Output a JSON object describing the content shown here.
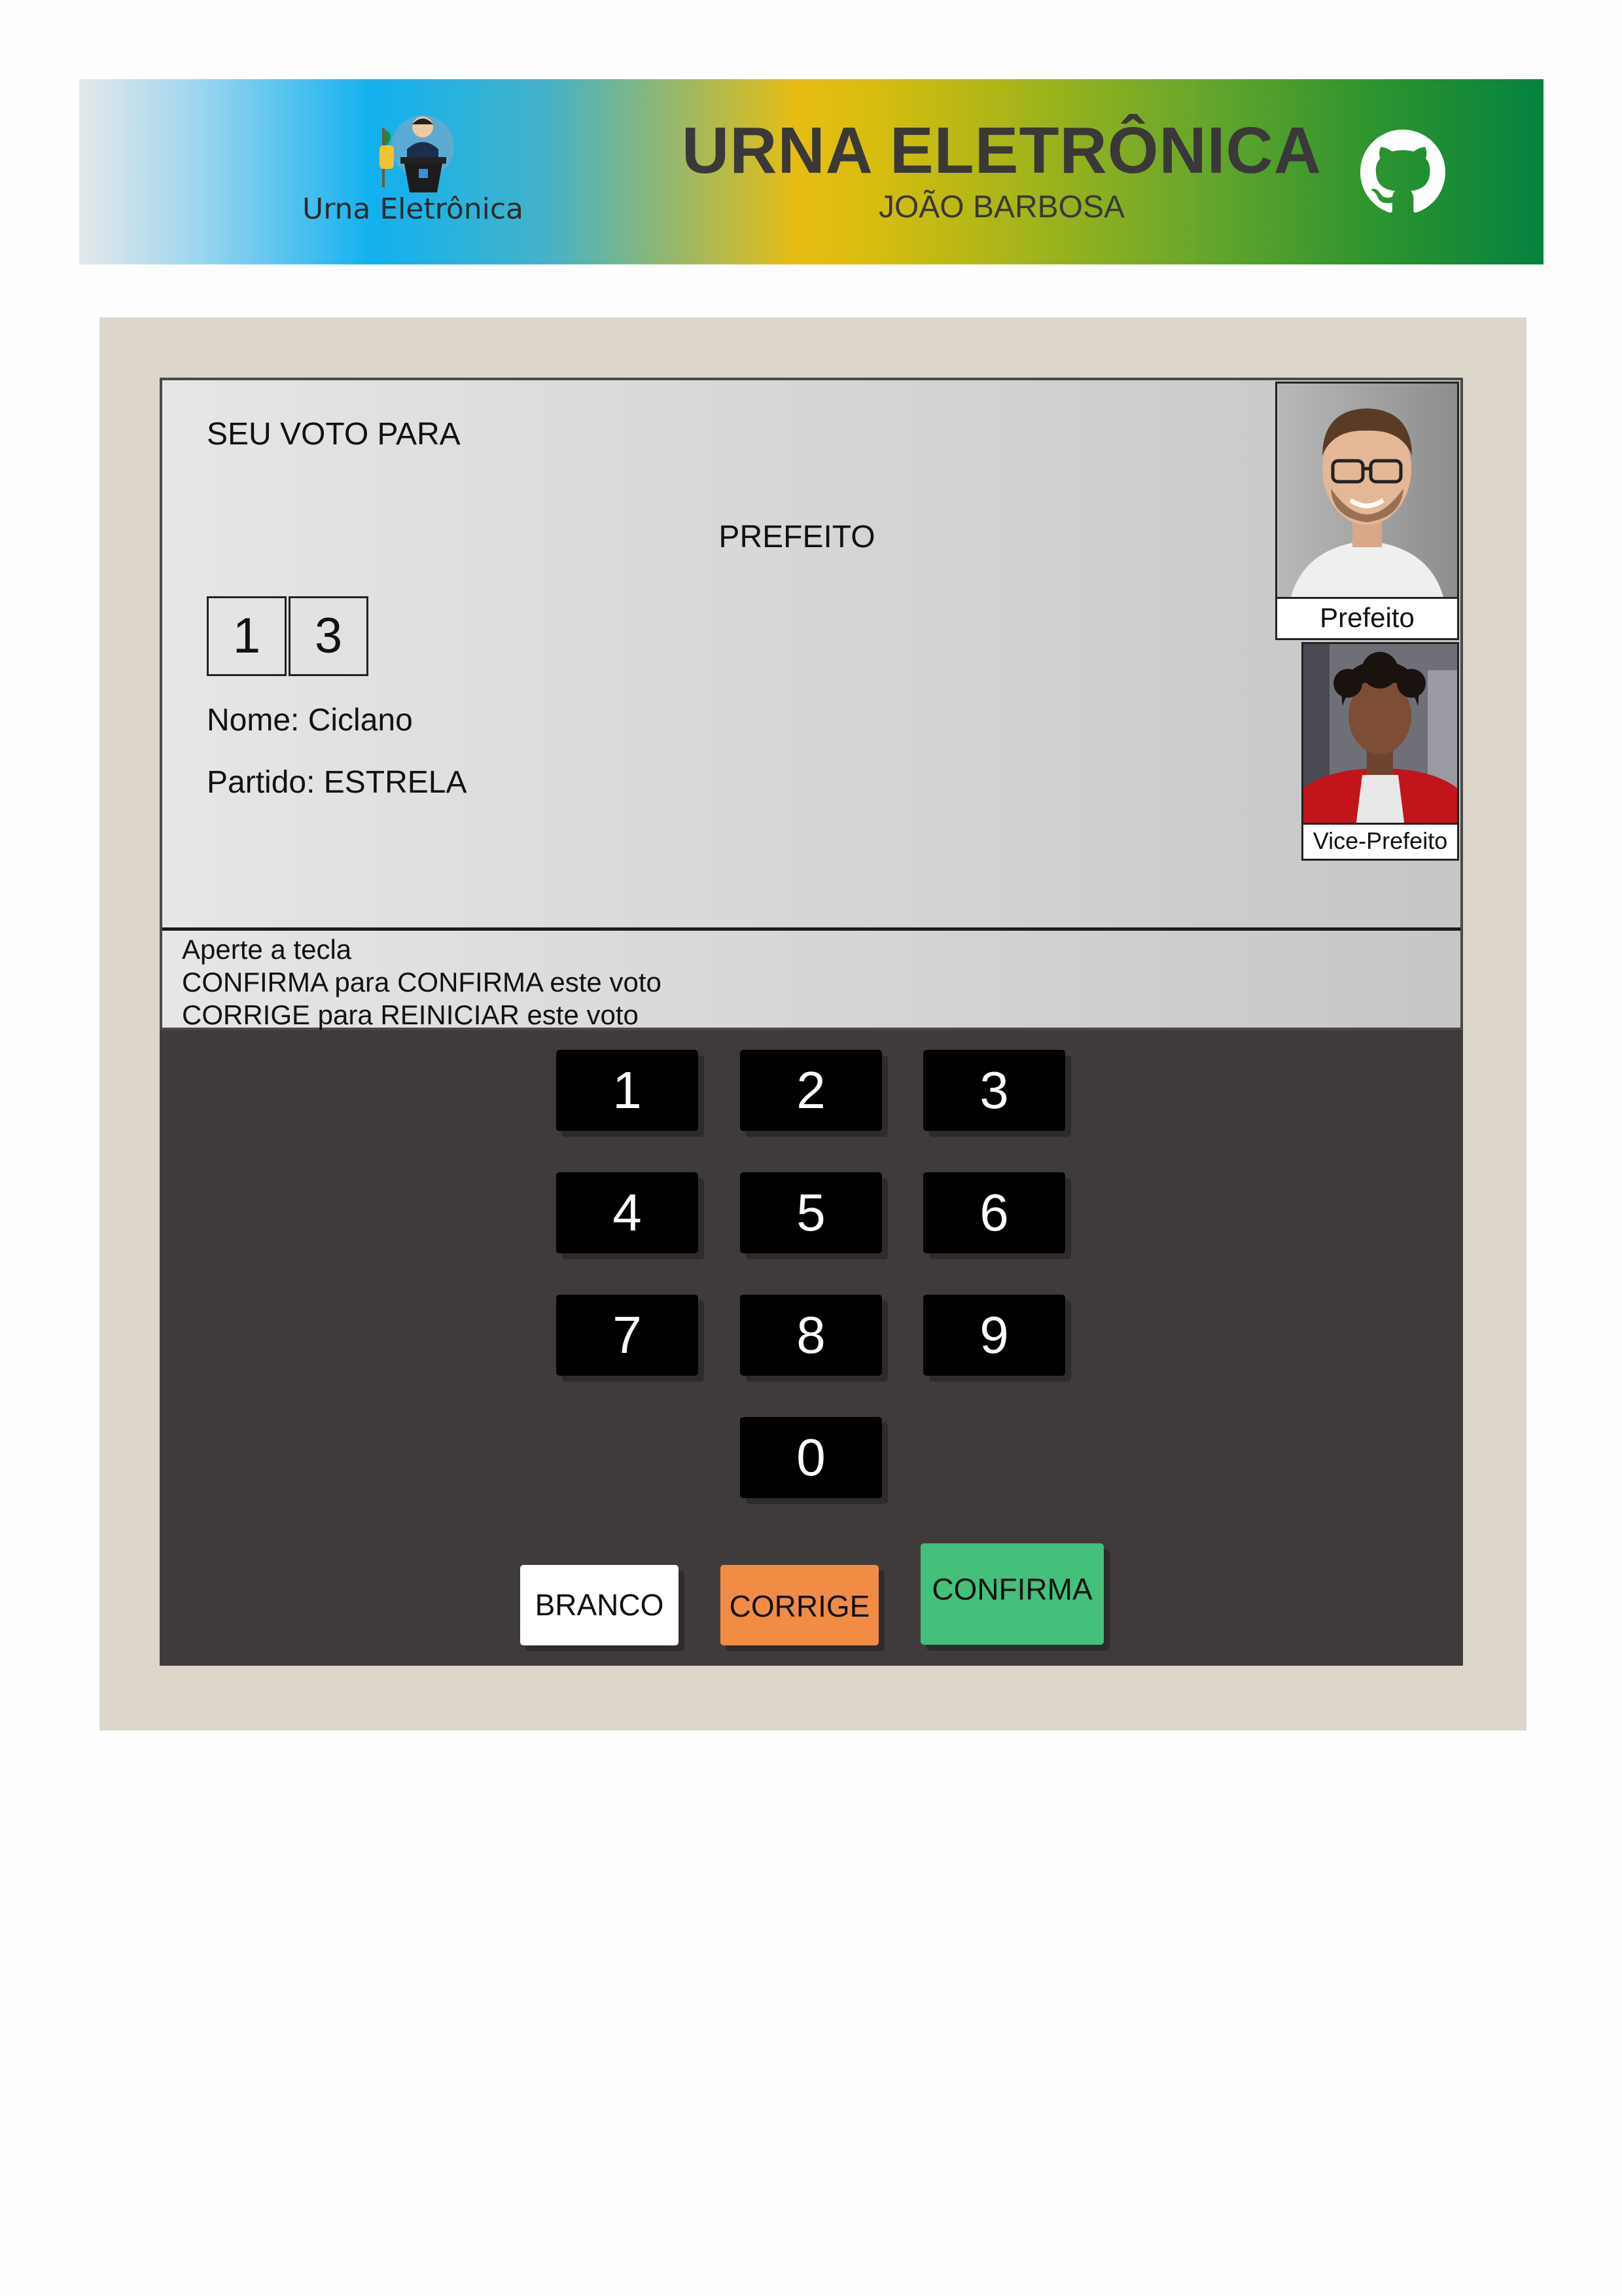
{
  "header": {
    "logo_text": "Urna Eletrônica",
    "title": "URNA ELETRÔNICA",
    "subtitle": "JOÃO BARBOSA",
    "github_icon": "github-icon"
  },
  "screen": {
    "heading": "SEU VOTO PARA",
    "cargo": "PREFEITO",
    "digits": [
      "1",
      "3"
    ],
    "nome": "Nome: Ciclano",
    "partido": "Partido: ESTRELA",
    "photo_main_label": "Prefeito",
    "photo_vice_label": "Vice-Prefeito",
    "aviso": {
      "line1": "Aperte a tecla",
      "line2": "CONFIRMA para CONFIRMA este voto",
      "line3": "CORRIGE para REINICIAR este voto"
    }
  },
  "keypad": {
    "keys": [
      "1",
      "2",
      "3",
      "4",
      "5",
      "6",
      "7",
      "8",
      "9",
      "0"
    ],
    "branco": "BRANCO",
    "corrige": "CORRIGE",
    "confirma": "CONFIRMA"
  },
  "colors": {
    "frame": "#dcd6cb",
    "keypad_bg": "#403b3b",
    "corrige": "#f08c43",
    "confirma": "#43c07a",
    "branco": "#ffffff"
  }
}
